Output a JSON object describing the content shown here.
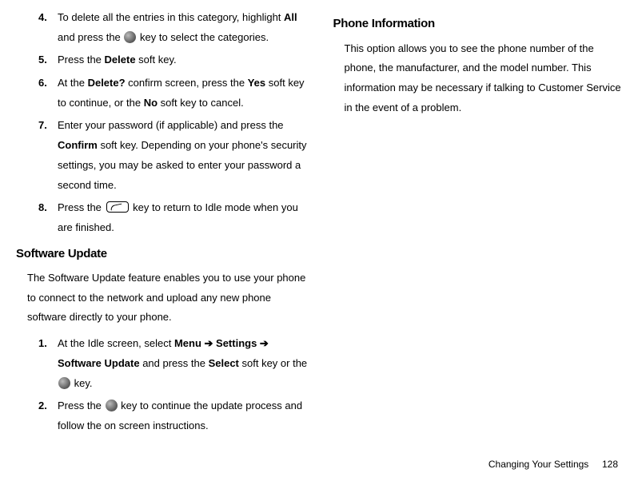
{
  "left": {
    "steps_a": [
      {
        "num": "4.",
        "pre": "To delete all the entries in this category, highlight ",
        "b1": "All",
        "mid": " and press the ",
        "icon": "circle",
        "post": " key to select the categories."
      },
      {
        "num": "5.",
        "pre": "Press the ",
        "b1": "Delete",
        "post": " soft key."
      },
      {
        "num": "6.",
        "pre": "At the ",
        "b1": "Delete?",
        "mid": " confirm screen, press the ",
        "b2": "Yes",
        "mid2": " soft key to continue, or the ",
        "b3": "No",
        "post": " soft key to cancel."
      },
      {
        "num": "7.",
        "pre": "Enter your password (if applicable) and press the ",
        "b1": "Confirm",
        "post": " soft key. Depending on your phone's security settings, you may be asked to enter your password a second time."
      },
      {
        "num": "8.",
        "pre": "Press the ",
        "icon": "key",
        "post": " key to return to Idle mode when you are finished."
      }
    ],
    "sw_heading": "Software Update",
    "sw_para": "The Software Update feature enables you to use your phone to connect to the network and upload any new phone software directly to your phone.",
    "steps_b": [
      {
        "num": "1.",
        "pre": "At the Idle screen, select ",
        "b1": "Menu ➔ Settings ➔ Software Update",
        "mid": " and press the ",
        "b2": "Select",
        "mid2": " soft key or the ",
        "icon": "circle",
        "post": " key."
      },
      {
        "num": "2.",
        "pre": "Press the ",
        "icon": "circle",
        "post": " key to continue the update process and follow the on screen instructions."
      }
    ]
  },
  "right": {
    "heading": "Phone Information",
    "para": "This option allows you to see the phone number of the phone, the manufacturer, and the model number. This information may be necessary if talking to Customer Service in the event of a problem."
  },
  "footer": {
    "section": "Changing Your Settings",
    "page": "128"
  }
}
